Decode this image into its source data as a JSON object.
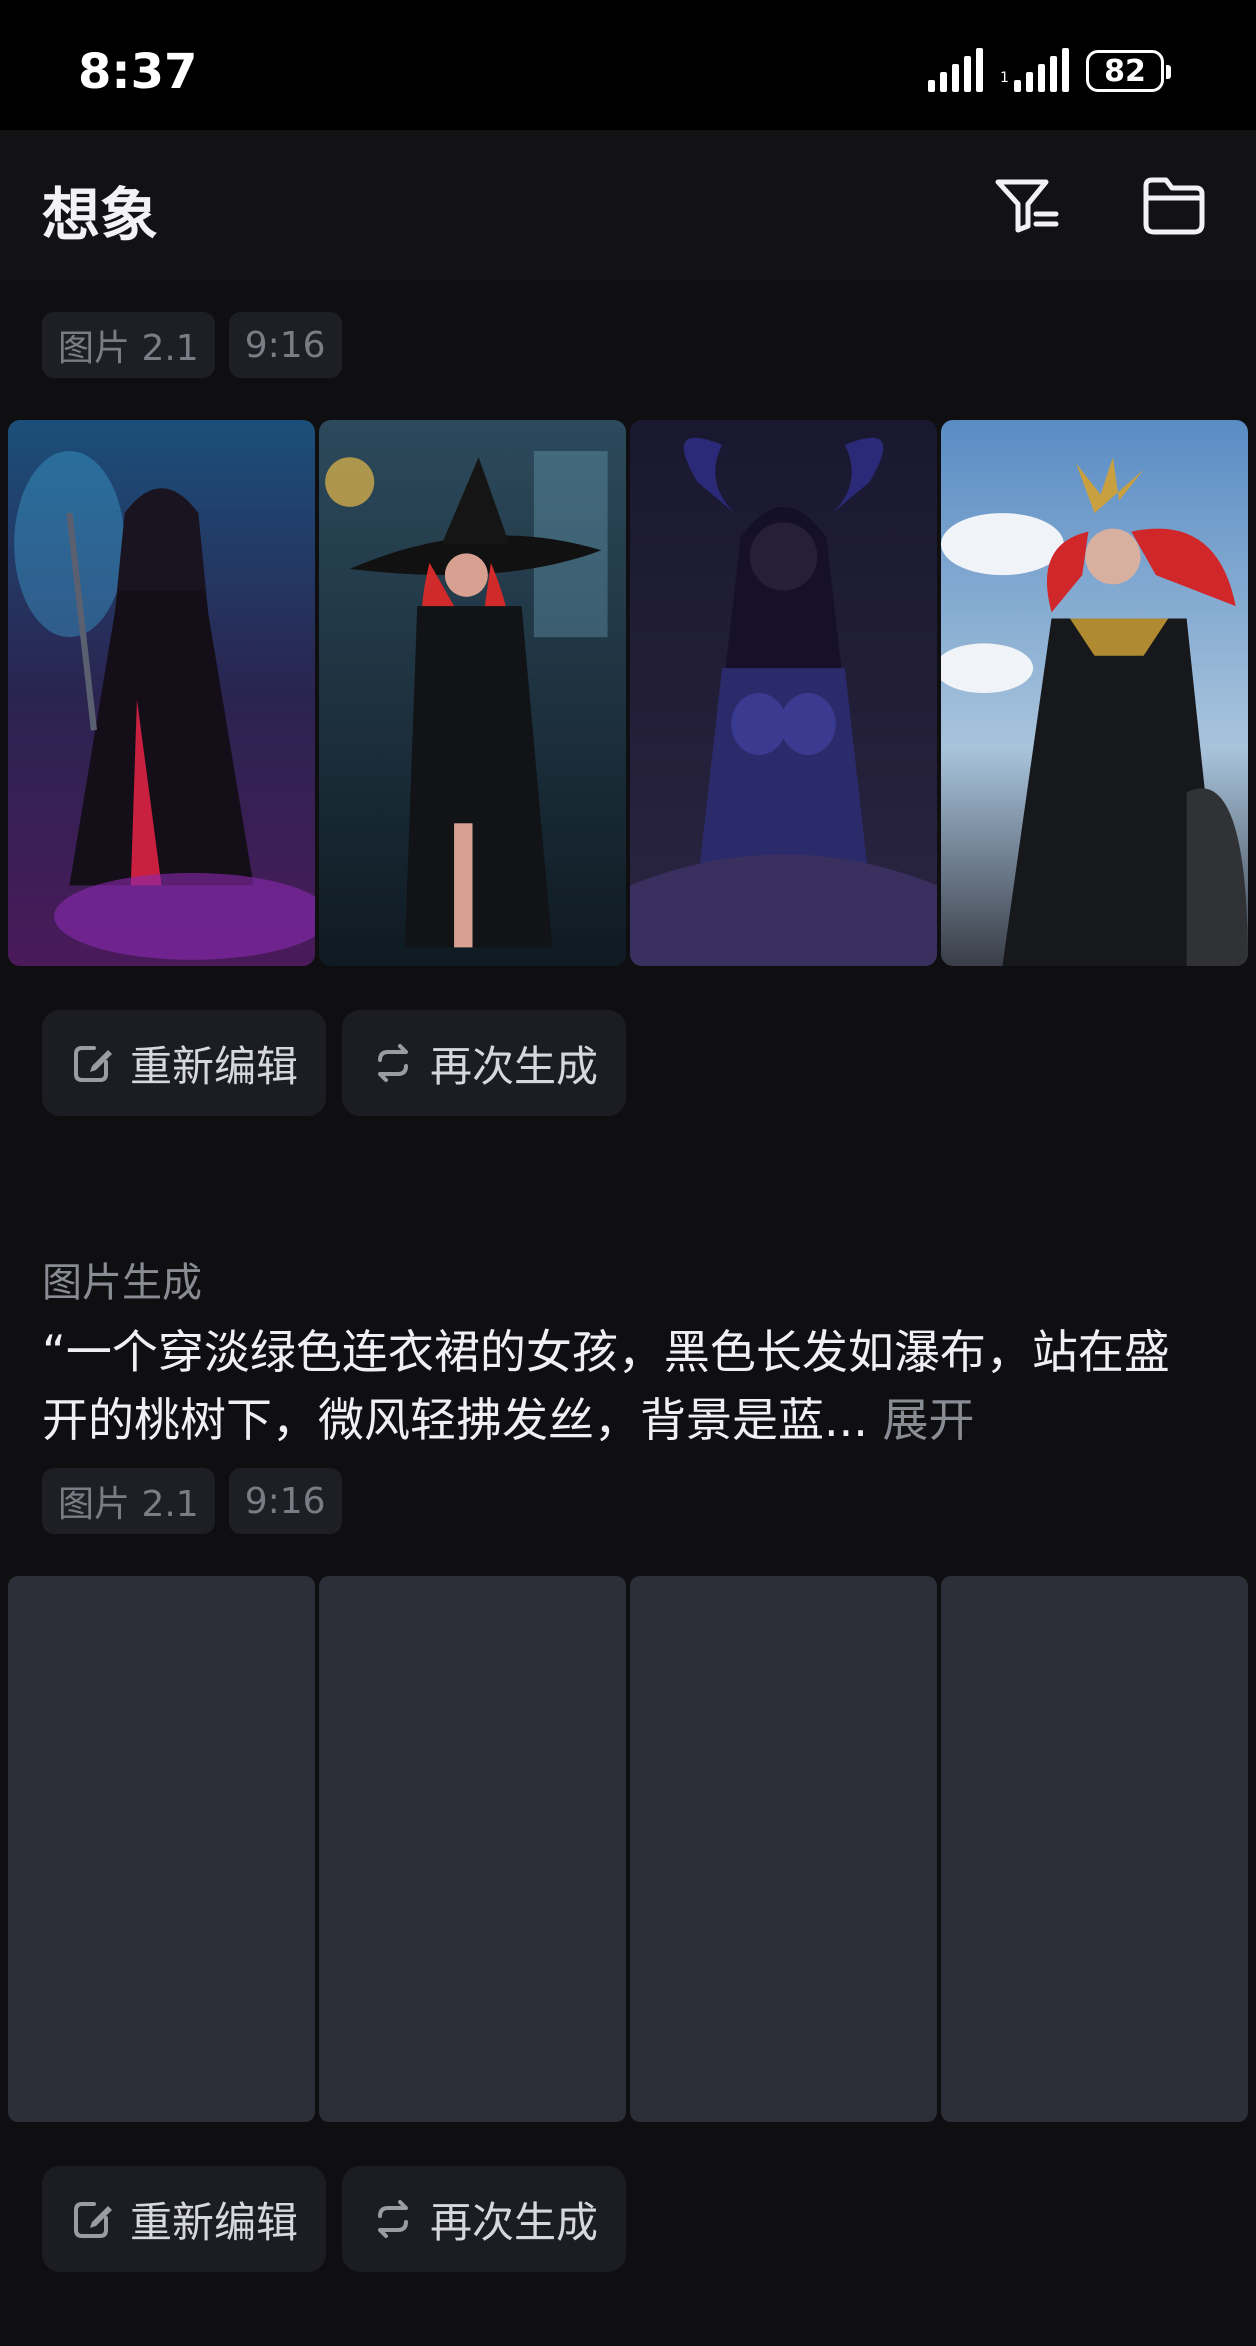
{
  "status_bar": {
    "time": "8:37",
    "battery": "82",
    "signal_small": "1"
  },
  "header": {
    "title": "想象",
    "filter_icon": "filter-icon",
    "folder_icon": "folder-icon"
  },
  "results": [
    {
      "tags": [
        "图片 2.1",
        "9:16"
      ],
      "images": [
        "dark sorceress with staff in purple mist",
        "red-haired witch in black hat and coat",
        "horned woman in dark purple armor",
        "red-haired woman with golden crown praying"
      ],
      "actions": [
        "重新编辑",
        "再次生成"
      ]
    },
    {
      "section_label": "图片生成",
      "prompt": "“一个穿淡绿色连衣裙的女孩，黑色长发如瀑布，站在盛开的桃树下，微风轻拂发丝，背景是蓝...",
      "expand_label": "展开",
      "tags": [
        "图片 2.1",
        "9:16"
      ],
      "actions": [
        "重新编辑",
        "再次生成"
      ]
    }
  ],
  "colors": {
    "background": "#0f0f11",
    "tag_bg": "#1e1f24",
    "button_bg": "#1c1d22",
    "placeholder": "#2c2e38"
  }
}
